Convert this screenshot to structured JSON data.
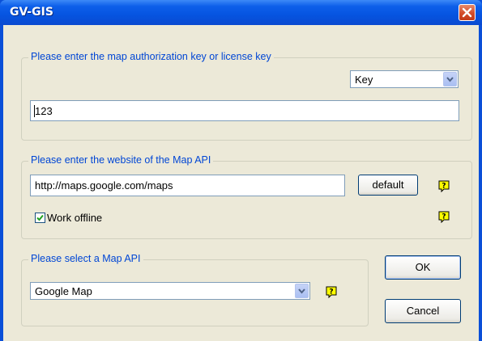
{
  "window": {
    "title": "GV-GIS"
  },
  "key_group": {
    "legend": "Please enter the map authorization key or license key",
    "key_type": "Key",
    "key_value": "123"
  },
  "website_group": {
    "legend": "Please enter the website of the Map API",
    "url": "http://maps.google.com/maps",
    "default_label": "default",
    "offline_label": "Work offline",
    "offline_checked": true
  },
  "api_group": {
    "legend": "Please select a Map API",
    "selected_api": "Google Map"
  },
  "buttons": {
    "ok": "OK",
    "cancel": "Cancel"
  },
  "colors": {
    "legend_text": "#0046d5",
    "titlebar": "#0654e0",
    "dialog_bg": "#ece9d8",
    "help_icon": "#ffff00"
  },
  "icons": {
    "help": "help-icon",
    "close": "close-icon",
    "check": "check-icon",
    "dropdown": "chevron-down-icon"
  }
}
